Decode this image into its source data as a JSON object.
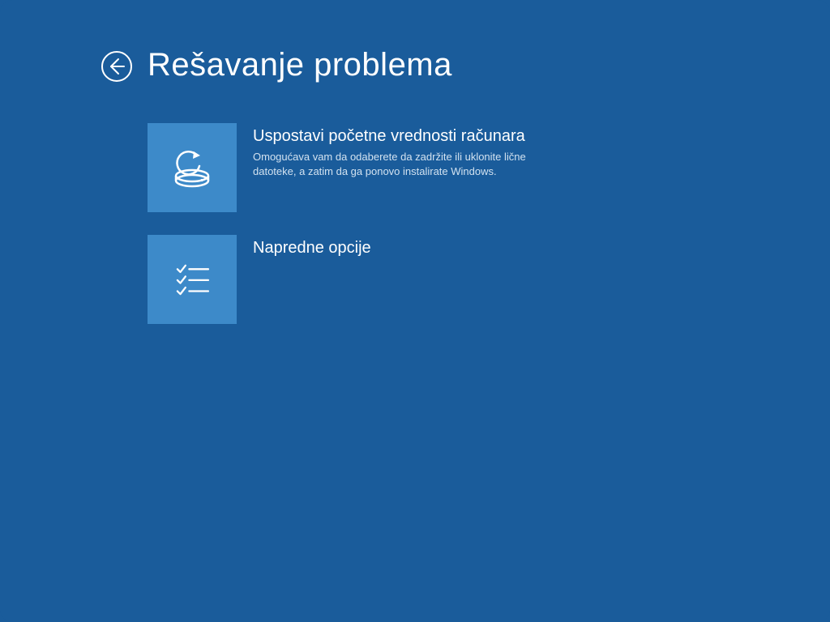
{
  "colors": {
    "background": "#1a5c9b",
    "tile": "#3d8ac9",
    "text": "#ffffff",
    "desc": "#d2e2f0"
  },
  "header": {
    "title": "Rešavanje problema"
  },
  "options": [
    {
      "icon": "reset-pc-icon",
      "title": "Uspostavi početne vrednosti računara",
      "description": "Omogućava vam da odaberete da zadržite ili uklonite lične datoteke, a zatim da ga ponovo instalirate Windows."
    },
    {
      "icon": "advanced-options-icon",
      "title": "Napredne opcije",
      "description": ""
    }
  ]
}
